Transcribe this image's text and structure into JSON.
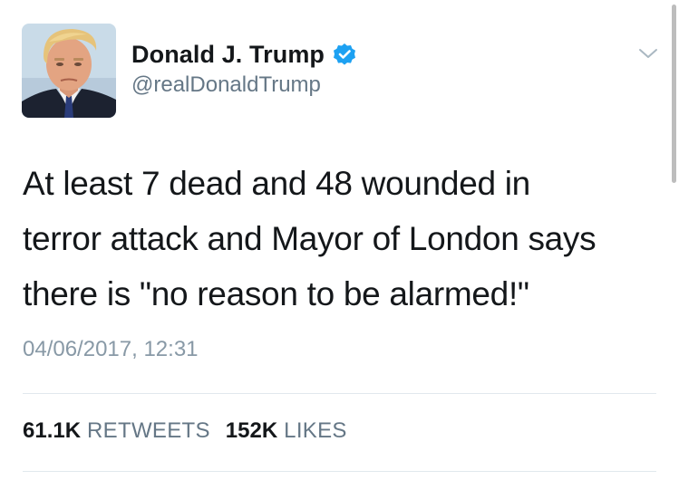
{
  "tweet": {
    "author": {
      "display_name": "Donald J. Trump",
      "handle": "@realDonaldTrump",
      "verified": true,
      "avatar_icon": "profile-photo"
    },
    "text": "At least 7 dead and 48 wounded in\nterror attack and Mayor of London says\nthere is \"no reason to be alarmed!\"",
    "timestamp": "04/06/2017, 12:31",
    "stats": {
      "retweets_count": "61.1K",
      "retweets_label": "RETWEETS",
      "likes_count": "152K",
      "likes_label": "LIKES"
    },
    "menu_icon": "chevron-down-icon"
  },
  "colors": {
    "text_primary": "#14171a",
    "text_secondary": "#657786",
    "timestamp": "#8899a6",
    "verified_blue": "#1da1f2",
    "divider": "#e1e8ed"
  }
}
